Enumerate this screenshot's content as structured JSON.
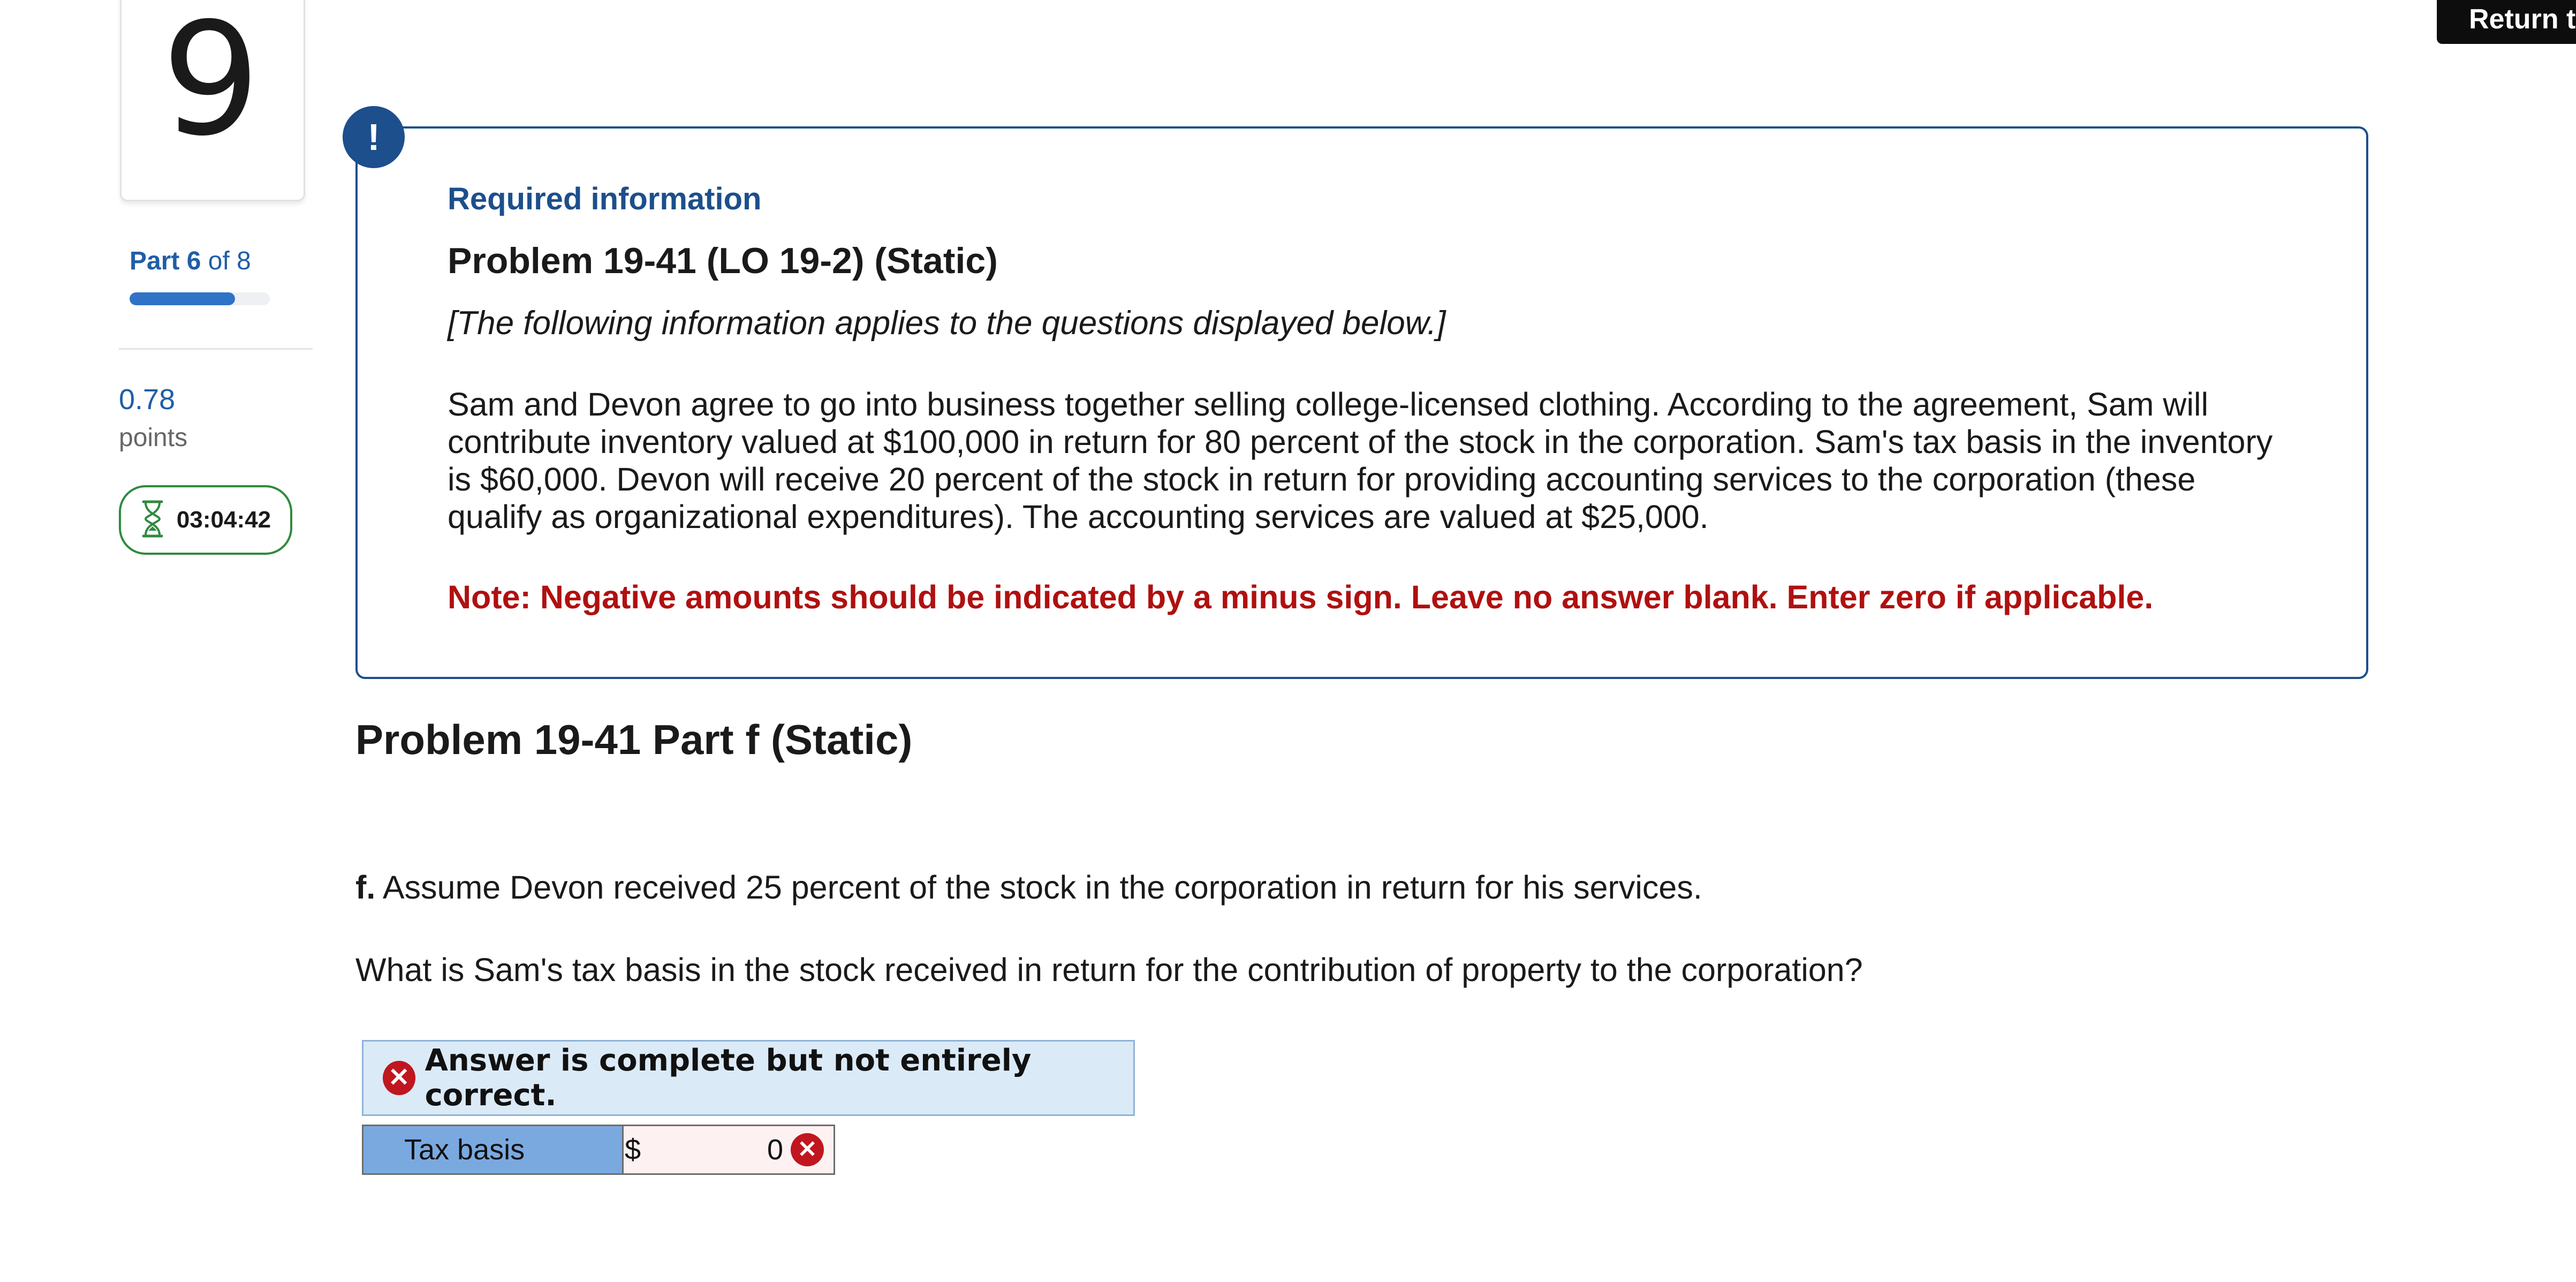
{
  "sidebar": {
    "question_number": "9",
    "part_prefix": "Part",
    "part_current": "6",
    "part_of": "of 8",
    "progress_fraction": 0.75,
    "points_value": "0.78",
    "points_label": "points",
    "timer": "03:04:42",
    "timer_icon": "hourglass-icon"
  },
  "header": {
    "return_button": "Return to"
  },
  "required_info": {
    "icon_text": "!",
    "label": "Required information",
    "problem_title": "Problem 19-41 (LO 19-2) (Static)",
    "intro": "[The following information applies to the questions displayed below.]",
    "scenario": "Sam and Devon agree to go into business together selling college-licensed clothing. According to the agreement, Sam will contribute inventory valued at $100,000 in return for 80 percent of the stock in the corporation. Sam's tax basis in the inventory is $60,000. Devon will receive 20 percent of the stock in return for providing accounting services to the corporation (these qualify as organizational expenditures). The accounting services are valued at $25,000.",
    "note": "Note: Negative amounts should be indicated by a minus sign. Leave no answer blank. Enter zero if applicable."
  },
  "part": {
    "heading": "Problem 19-41 Part f (Static)",
    "question_letter": "f.",
    "question_text": "Assume Devon received 25 percent of the stock in the corporation in return for his services.",
    "question_prompt": "What is Sam's tax basis in the stock received in return for the contribution of property to the corporation?"
  },
  "feedback": {
    "icon": "error-icon",
    "message": "Answer is complete but not entirely correct.",
    "row_label": "Tax basis",
    "currency": "$",
    "value": "0",
    "colors": {
      "error": "#c0161f",
      "label_bg": "#7aa9e0",
      "feedback_bg": "#dbeaf7",
      "note": "#b01010",
      "accent": "#1c4f8c"
    }
  }
}
